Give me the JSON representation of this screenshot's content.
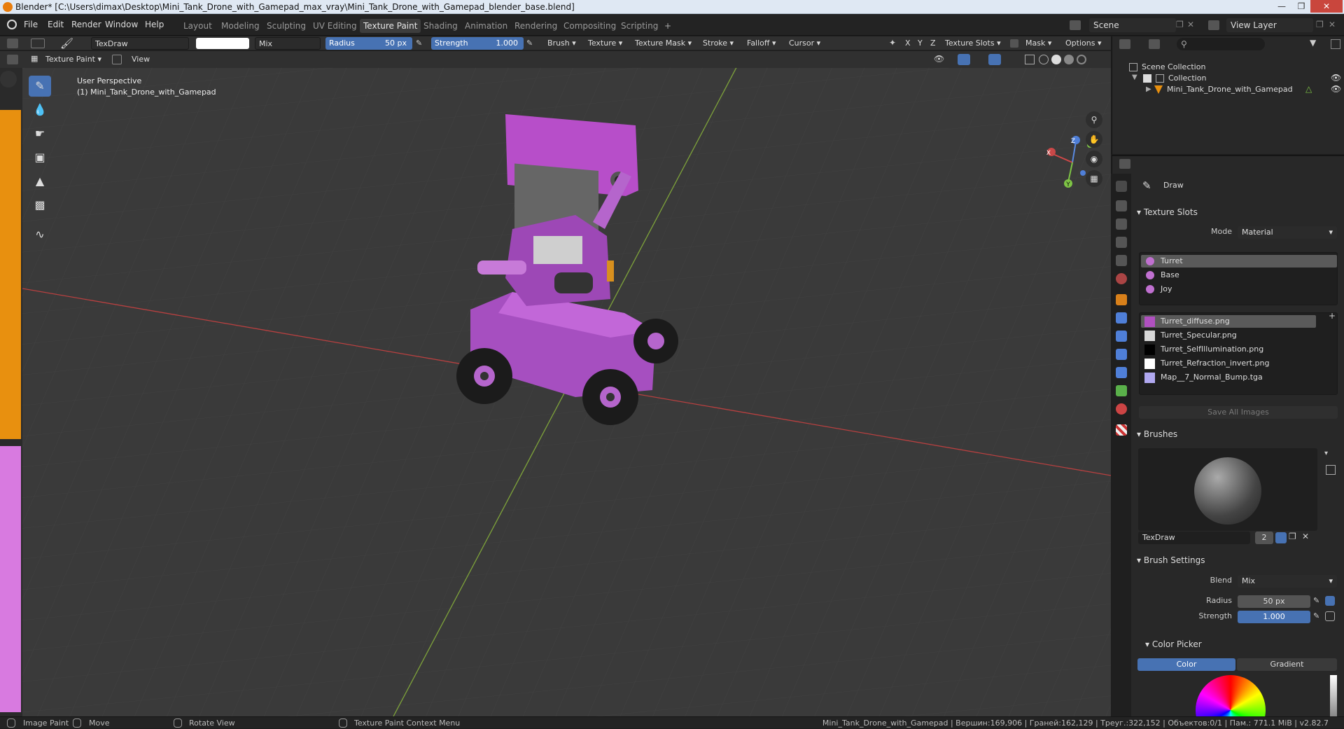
{
  "window": {
    "title": "Blender* [C:\\Users\\dimax\\Desktop\\Mini_Tank_Drone_with_Gamepad_max_vray\\Mini_Tank_Drone_with_Gamepad_blender_base.blend]"
  },
  "menu": [
    "File",
    "Edit",
    "Render",
    "Window",
    "Help"
  ],
  "workspaces": [
    {
      "label": "Layout",
      "active": false
    },
    {
      "label": "Modeling",
      "active": false
    },
    {
      "label": "Sculpting",
      "active": false
    },
    {
      "label": "UV Editing",
      "active": false
    },
    {
      "label": "Texture Paint",
      "active": true
    },
    {
      "label": "Shading",
      "active": false
    },
    {
      "label": "Animation",
      "active": false
    },
    {
      "label": "Rendering",
      "active": false
    },
    {
      "label": "Compositing",
      "active": false
    },
    {
      "label": "Scripting",
      "active": false
    }
  ],
  "scene": {
    "label": "Scene"
  },
  "view_layer": {
    "label": "View Layer"
  },
  "tool_header": {
    "brush_name": "TexDraw",
    "blend": "Mix",
    "radius_label": "Radius",
    "radius_value": "50 px",
    "strength_label": "Strength",
    "strength_value": "1.000",
    "brush": "Brush",
    "texture": "Texture",
    "texture_mask": "Texture Mask",
    "stroke": "Stroke",
    "falloff": "Falloff",
    "cursor": "Cursor",
    "x": "X",
    "y": "Y",
    "z": "Z",
    "texture_slots": "Texture Slots",
    "mask": "Mask",
    "options": "Options"
  },
  "sub_header": {
    "mode": "Texture Paint",
    "view": "View"
  },
  "viewport": {
    "perspective": "User Perspective",
    "object": "(1) Mini_Tank_Drone_with_Gamepad"
  },
  "gizmo": {
    "x": "X",
    "y": "Y",
    "z": "Z"
  },
  "outliner": {
    "scene_collection": "Scene Collection",
    "collection": "Collection",
    "object": "Mini_Tank_Drone_with_Gamepad"
  },
  "properties": {
    "tool_name": "Draw",
    "texture_slots_title": "Texture Slots",
    "mode_label": "Mode",
    "mode_value": "Material",
    "materials": [
      {
        "name": "Turret",
        "color": "#c070d0",
        "selected": true
      },
      {
        "name": "Base",
        "color": "#c070d0",
        "selected": false
      },
      {
        "name": "Joy",
        "color": "#c070d0",
        "selected": false
      }
    ],
    "images": [
      {
        "name": "Turret_diffuse.png",
        "color": "#b050c0",
        "selected": true
      },
      {
        "name": "Turret_Specular.png",
        "color": "#d8d8d8",
        "selected": false
      },
      {
        "name": "Turret_SelfIllumination.png",
        "color": "#000000",
        "selected": false
      },
      {
        "name": "Turret_Refraction_invert.png",
        "color": "#ffffff",
        "selected": false
      },
      {
        "name": "Map__7_Normal_Bump.tga",
        "color": "#b0a8f0",
        "selected": false
      }
    ],
    "save_all_images": "Save All Images",
    "brushes_title": "Brushes",
    "brush_name": "TexDraw",
    "brush_users": "2",
    "brush_settings_title": "Brush Settings",
    "blend_label": "Blend",
    "blend_value": "Mix",
    "radius_label": "Radius",
    "radius_value": "50 px",
    "strength_label": "Strength",
    "strength_value": "1.000",
    "color_picker_title": "Color Picker",
    "color_tab": "Color",
    "gradient_tab": "Gradient"
  },
  "status": {
    "left1": "Image Paint",
    "left2": "Move",
    "left3": "Rotate View",
    "left4": "Texture Paint Context Menu",
    "right": "Mini_Tank_Drone_with_Gamepad | Вершин:169,906 | Граней:162,129 | Треуг.:322,152 | Объектов:0/1 | Пам.: 771.1 MiB | v2.82.7"
  },
  "colors": {
    "accent": "#4772b3",
    "model": "#a64fc0",
    "viewport_bg": "#3a3a3a"
  }
}
